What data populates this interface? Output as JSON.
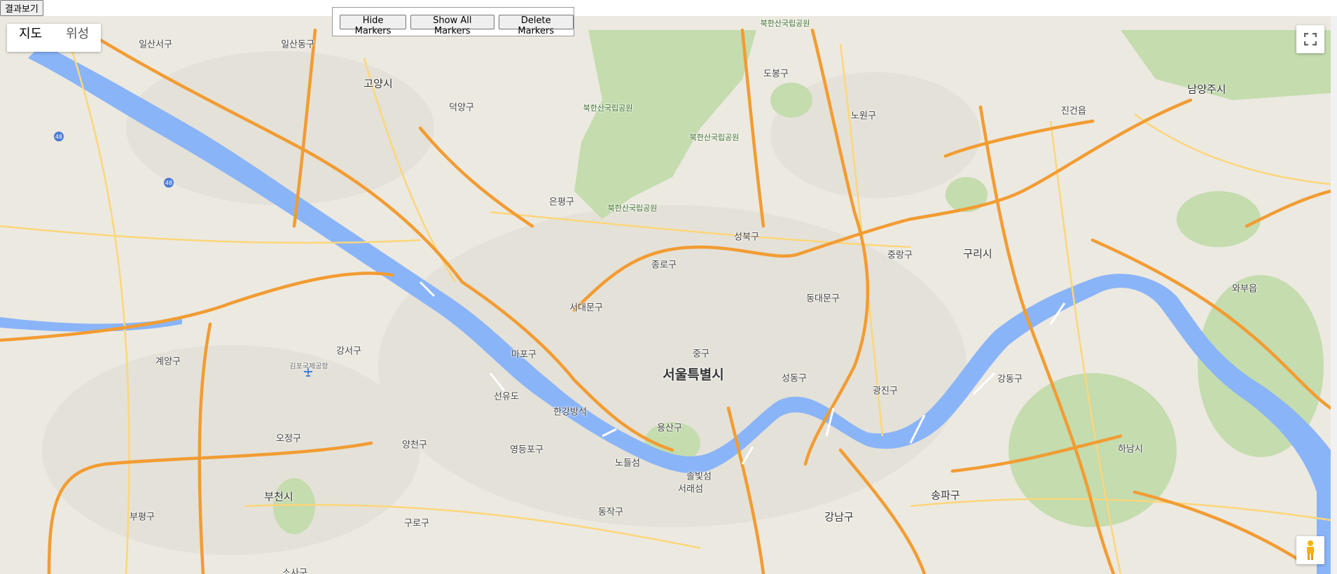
{
  "top_button_label": "결과보기",
  "map_type": {
    "map": "지도",
    "satellite": "위성"
  },
  "controls": {
    "hide": "Hide Markers",
    "show_all": "Show All Markers",
    "delete": "Delete Markers"
  },
  "icons": {
    "fullscreen": "fullscreen-icon",
    "pegman": "pegman-icon",
    "airport": "airport-icon"
  },
  "colors": {
    "land": "#ece9e1",
    "water": "#8ab4f8",
    "park": "#c4dcae",
    "major_road": "#f29c32",
    "road": "#fbd67a"
  },
  "highway_shields": [
    "48",
    "48"
  ],
  "labels": {
    "seoul": "서울특별시",
    "goyang": "고양시",
    "namyangju": "남양주시",
    "guri": "구리시",
    "bucheon": "부천시",
    "hanam": "하남시",
    "ilsanseo": "일산서구",
    "ilsandong": "일산동구",
    "deokyang": "덕양구",
    "bukhansan": "북한산국립공원",
    "dobong": "도봉구",
    "nowon": "노원구",
    "jinjeop": "진건읍",
    "eunpyeong": "은평구",
    "seongbuk": "성북구",
    "jongno": "종로구",
    "jungnang": "중랑구",
    "dongdaemun": "동대문구",
    "seodaemun": "서대문구",
    "mapo": "마포구",
    "jung": "중구",
    "gangseo": "강서구",
    "gimpo_airport": "김포국제공항",
    "gyeyang": "계양구",
    "seonyudo": "선유도",
    "hangang": "한강방석",
    "seongdong": "성동구",
    "gwangjin": "광진구",
    "gangdong": "강동구",
    "yongsan": "용산구",
    "yeongdeungpo": "영등포구",
    "yangcheon": "양천구",
    "ojeong": "오정구",
    "nodeulseom": "노들섬",
    "solbitseom": "솔빛섬",
    "seoraeseom": "서래섬",
    "dongjak": "동작구",
    "gangnam": "강남구",
    "songpa": "송파구",
    "bupyeong": "부평구",
    "guro": "구로구",
    "sosa": "소사구",
    "wabu": "와부읍"
  }
}
